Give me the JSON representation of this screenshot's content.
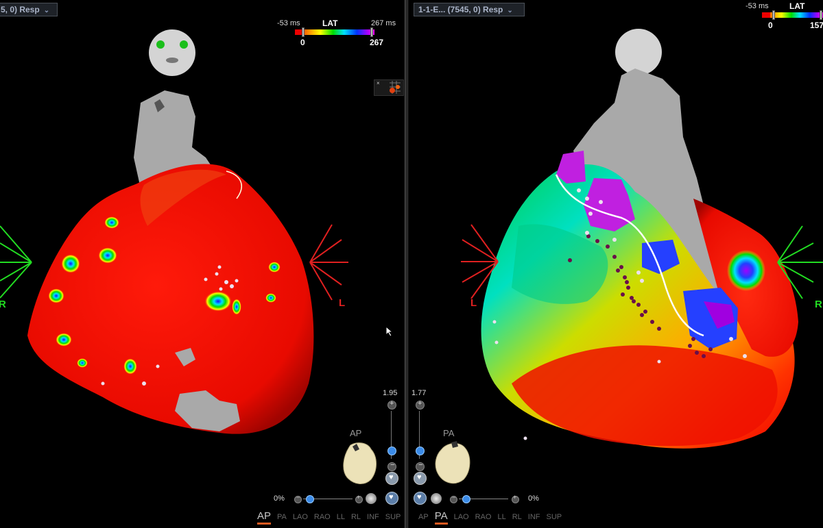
{
  "left": {
    "map_selector": "5, 0) Resp",
    "lat_legend": {
      "title": "LAT",
      "min_ms": "-53 ms",
      "max_ms": "267 ms",
      "low": "0",
      "high": "267"
    },
    "orientation": {
      "left_letter": "R",
      "right_letter": "L"
    },
    "zoom_value": "1.95",
    "view_label": "AP",
    "opacity": "0%",
    "view_tabs": [
      "AP",
      "PA",
      "LAO",
      "RAO",
      "LL",
      "RL",
      "INF",
      "SUP"
    ],
    "active_tab": 0
  },
  "right": {
    "map_selector": "1-1-E... (7545, 0) Resp",
    "lat_legend": {
      "title": "LAT",
      "min_ms": "-53 ms",
      "low": "0",
      "high": "157"
    },
    "orientation": {
      "left_letter": "L",
      "right_letter": "R"
    },
    "zoom_value": "1.77",
    "view_label": "PA",
    "opacity": "0%",
    "view_tabs": [
      "AP",
      "PA",
      "LAO",
      "RAO",
      "LL",
      "RL",
      "INF",
      "SUP"
    ],
    "active_tab": 1
  },
  "colors": {
    "lat_red": "#ee0000",
    "tab_accent": "#e05a20",
    "orient_red": "#e02020",
    "orient_green": "#22dd22"
  },
  "icons": [
    "face-icon",
    "orientation-arrow-icon",
    "heart-icon",
    "zoom-in-icon",
    "zoom-out-icon",
    "camera-icon",
    "cursor-icon"
  ]
}
